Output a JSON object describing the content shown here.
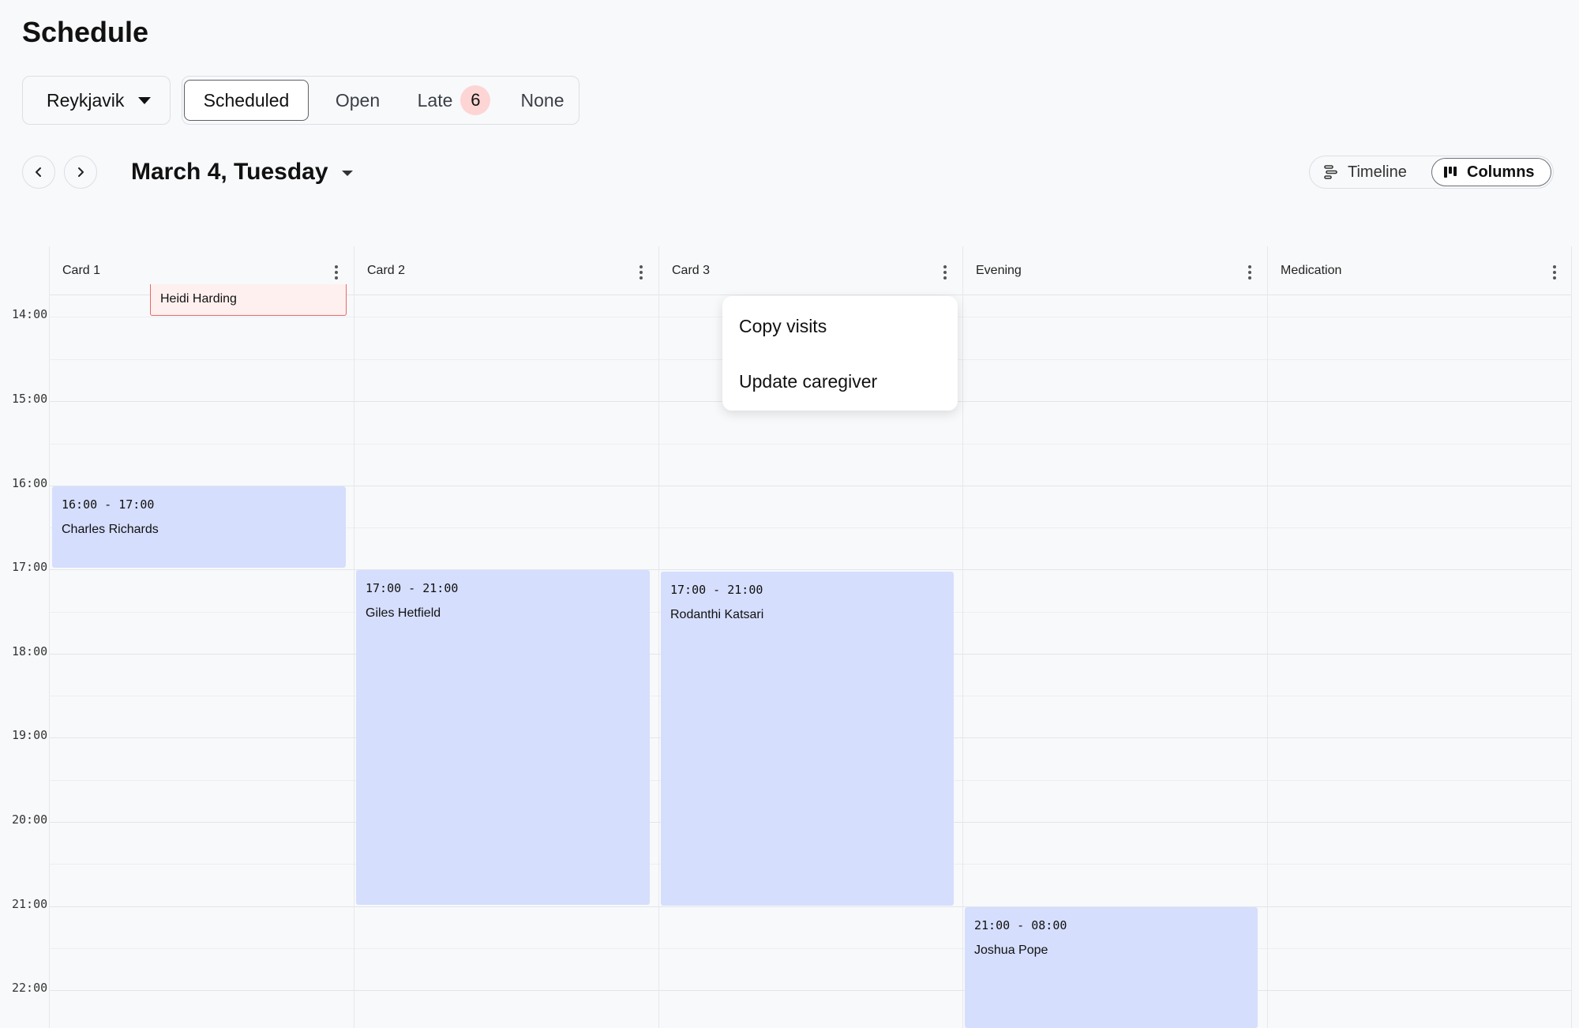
{
  "header": {
    "title": "Schedule"
  },
  "filters": {
    "location": "Reykjavik",
    "tabs": [
      "Scheduled",
      "Open",
      "Late",
      "None"
    ],
    "late_count": "6",
    "active_tab": "Scheduled"
  },
  "date_nav": {
    "date_label": "March 4, Tuesday"
  },
  "view_toggle": {
    "timeline_label": "Timeline",
    "columns_label": "Columns",
    "active": "Columns"
  },
  "columns": [
    "Card 1",
    "Card 2",
    "Card 3",
    "Evening",
    "Medication"
  ],
  "time_labels": [
    "14:00",
    "15:00",
    "16:00",
    "17:00",
    "18:00",
    "19:00",
    "20:00",
    "21:00",
    "22:00"
  ],
  "visits": {
    "late_visit_name": "Heidi Harding",
    "card1": {
      "time": "16:00 - 17:00",
      "name": "Charles Richards"
    },
    "card2": {
      "time": "17:00 - 21:00",
      "name": "Giles Hetfield"
    },
    "card3": {
      "time": "17:00 - 21:00",
      "name": "Rodanthi Katsari"
    },
    "evening": {
      "time": "21:00 - 08:00",
      "name": "Joshua Pope"
    }
  },
  "context_menu": {
    "items": [
      "Copy visits",
      "Update caregiver"
    ]
  },
  "colors": {
    "visit_bg": "#d5defc",
    "late_badge": "#fdd5d5",
    "late_border": "#e46a6a"
  }
}
